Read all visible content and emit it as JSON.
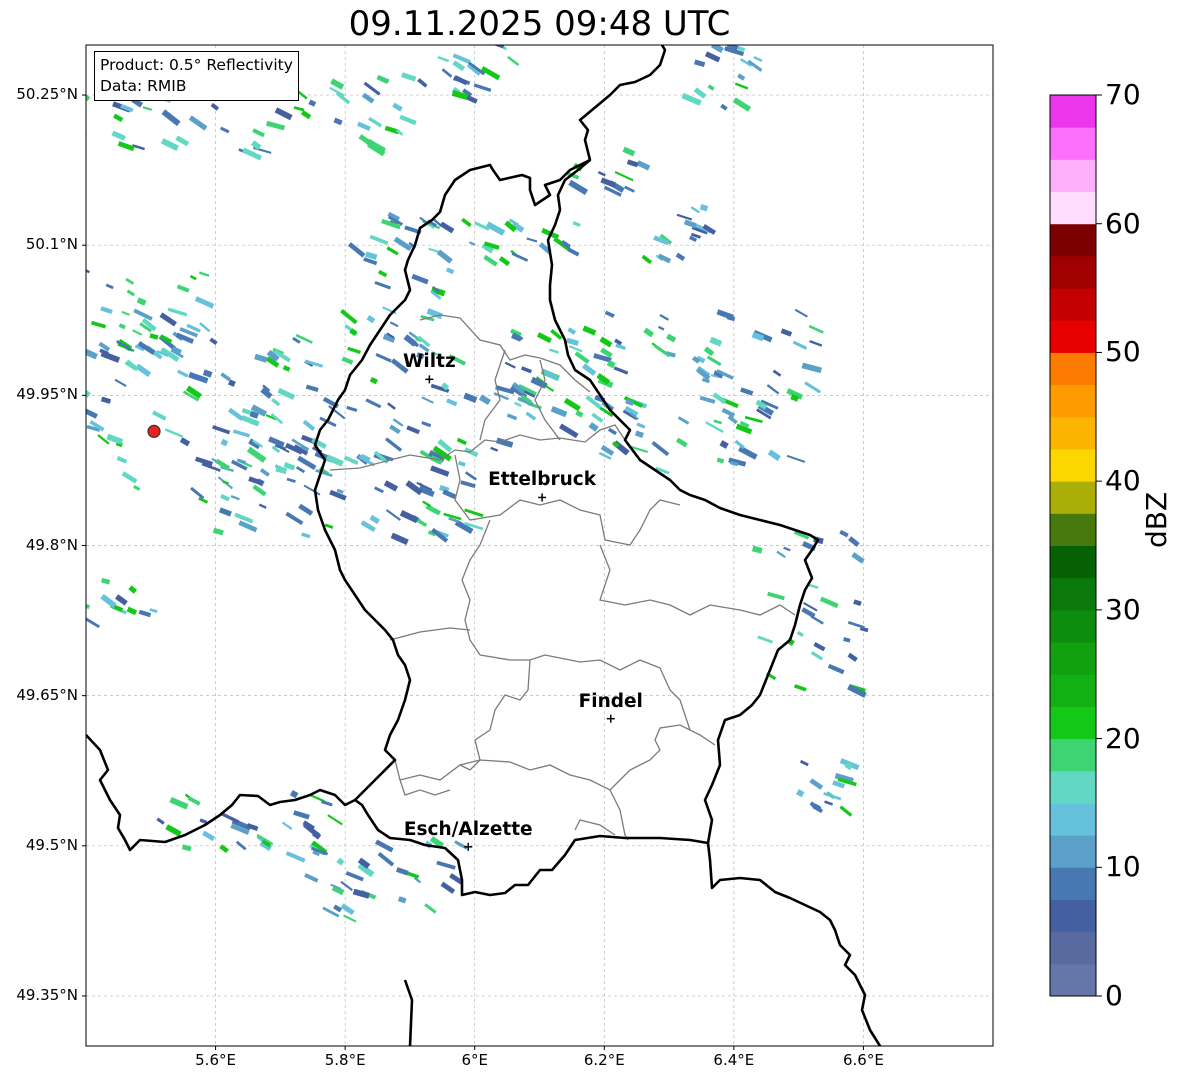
{
  "title": "09.11.2025 09:48 UTC",
  "info_box": {
    "product": "Product: 0.5° Reflectivity",
    "data": "Data: RMIB"
  },
  "map": {
    "lon_range": [
      5.4,
      6.8
    ],
    "lat_range": [
      49.3,
      50.3
    ],
    "lat_ticks": [
      {
        "value": 50.25,
        "label": "50.25°N"
      },
      {
        "value": 50.1,
        "label": "50.1°N"
      },
      {
        "value": 49.95,
        "label": "49.95°N"
      },
      {
        "value": 49.8,
        "label": "49.8°N"
      },
      {
        "value": 49.65,
        "label": "49.65°N"
      },
      {
        "value": 49.5,
        "label": "49.5°N"
      },
      {
        "value": 49.35,
        "label": "49.35°N"
      }
    ],
    "lon_ticks": [
      {
        "value": 5.6,
        "label": "5.6°E"
      },
      {
        "value": 5.8,
        "label": "5.8°E"
      },
      {
        "value": 6.0,
        "label": "6°E"
      },
      {
        "value": 6.2,
        "label": "6.2°E"
      },
      {
        "value": 6.4,
        "label": "6.4°E"
      },
      {
        "value": 6.6,
        "label": "6.6°E"
      }
    ],
    "cities": [
      {
        "name": "Wiltz",
        "lon": 5.93,
        "lat": 49.966
      },
      {
        "name": "Ettelbruck",
        "lon": 6.104,
        "lat": 49.848
      },
      {
        "name": "Findel",
        "lon": 6.21,
        "lat": 49.627
      },
      {
        "name": "Esch/Alzette",
        "lon": 5.99,
        "lat": 49.499
      }
    ],
    "radar_site": {
      "lon": 5.505,
      "lat": 49.914,
      "color": "#e8231c"
    },
    "gridlines": true
  },
  "colorbar": {
    "label": "dBZ",
    "ticks": [
      0,
      10,
      20,
      30,
      40,
      50,
      60,
      70
    ],
    "min": 0,
    "max": 70,
    "step": 2.5,
    "colors": [
      "#6577a8",
      "#586aa0",
      "#4460a0",
      "#4878b2",
      "#5aa0c8",
      "#66c2dc",
      "#62d8c4",
      "#3ed474",
      "#14c818",
      "#12b012",
      "#10a010",
      "#0e8c0e",
      "#0a780a",
      "#066004",
      "#467a0c",
      "#acae08",
      "#fcd600",
      "#fcb400",
      "#fc9c00",
      "#fc7c00",
      "#e80000",
      "#c40000",
      "#a00000",
      "#7c0000",
      "#fedcfe",
      "#fcb0fc",
      "#fc70fc",
      "#ec36ec"
    ]
  }
}
